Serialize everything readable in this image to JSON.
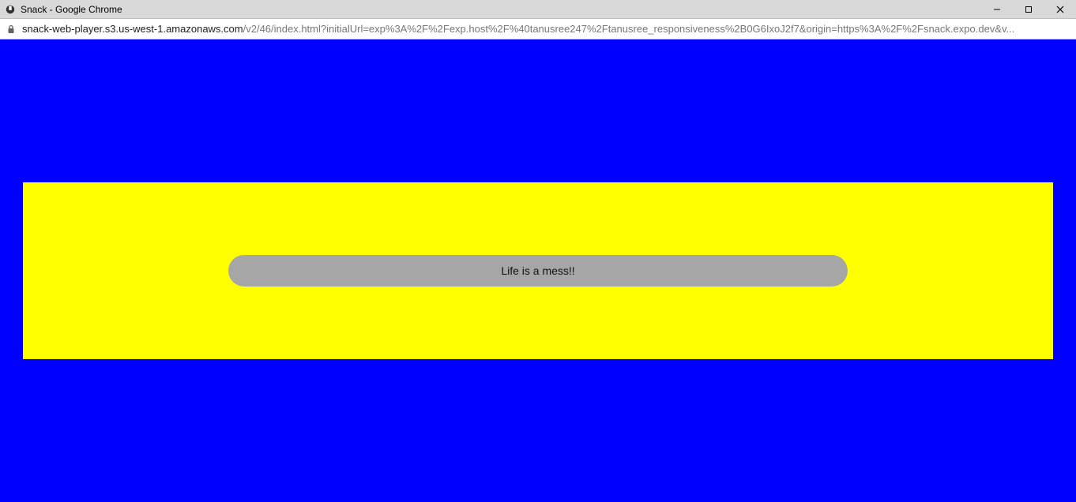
{
  "window": {
    "title": "Snack - Google Chrome"
  },
  "address": {
    "host": "snack-web-player.s3.us-west-1.amazonaws.com",
    "path": "/v2/46/index.html?initialUrl=exp%3A%2F%2Fexp.host%2F%40tanusree247%2Ftanusree_responsiveness%2B0G6IxoJ2f7&origin=https%3A%2F%2Fsnack.expo.dev&v..."
  },
  "content": {
    "message": "Life is a mess!!"
  }
}
